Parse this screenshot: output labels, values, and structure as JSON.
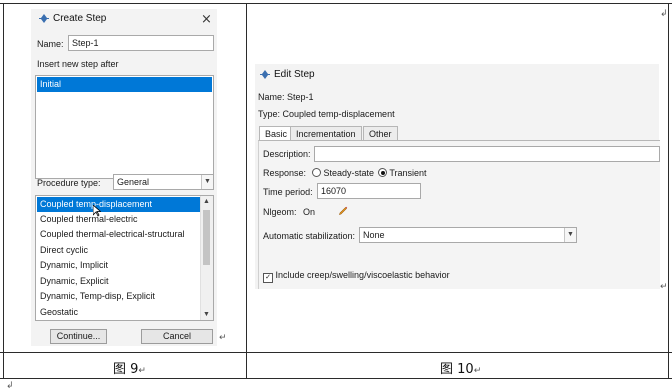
{
  "left_dialog": {
    "title": "Create Step",
    "close_glyph": "×",
    "name_label": "Name:",
    "name_value": "Step-1",
    "insert_label": "Insert new step after",
    "insert_list": [
      "Initial"
    ],
    "procedure_label": "Procedure type:",
    "procedure_value": "General",
    "procedures": [
      "Coupled temp-displacement",
      "Coupled thermal-electric",
      "Coupled thermal-electrical-structural",
      "Direct cyclic",
      "Dynamic, Implicit",
      "Dynamic, Explicit",
      "Dynamic, Temp-disp, Explicit",
      "Geostatic"
    ],
    "continue_label": "Continue...",
    "cancel_label": "Cancel",
    "scroll_up": "▲",
    "scroll_down": "▼"
  },
  "right_dialog": {
    "title": "Edit Step",
    "name_line": "Name:  Step-1",
    "type_line": "Type:  Coupled temp-displacement",
    "tabs": [
      "Basic",
      "Incrementation",
      "Other"
    ],
    "description_label": "Description:",
    "description_value": "",
    "response_label": "Response:",
    "response_options": [
      "Steady-state",
      "Transient"
    ],
    "response_selected": "Transient",
    "time_period_label": "Time period:",
    "time_period_value": "16070",
    "nlgeom_label": "Nlgeom:",
    "nlgeom_value": "On",
    "stabilization_label": "Automatic stabilization:",
    "stabilization_value": "None",
    "creep_label": "Include creep/swelling/viscoelastic behavior"
  },
  "captions": {
    "left": "图 9",
    "right": "图 10"
  },
  "marks": {
    "return": "↵",
    "small_return": "↲"
  }
}
